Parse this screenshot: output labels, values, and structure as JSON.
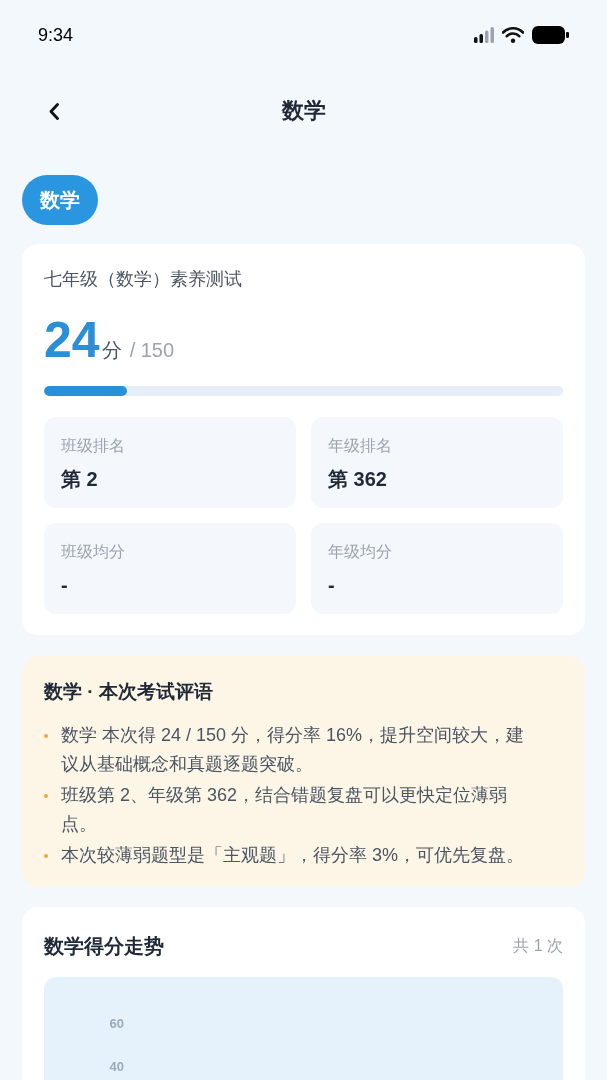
{
  "status_bar": {
    "time": "9:34"
  },
  "header": {
    "title": "数学"
  },
  "subject_tabs": [
    {
      "label": "数学",
      "selected": true
    }
  ],
  "score_card": {
    "exam_title": "七年级（数学）素养测试",
    "score": "24",
    "unit": "分",
    "total": "/ 150",
    "progress": {
      "level": 0.16
    },
    "stats": [
      {
        "label": "班级排名",
        "value": "第 2"
      },
      {
        "label": "年级排名",
        "value": "第 362"
      },
      {
        "label": "班级均分",
        "value": "-"
      },
      {
        "label": "年级均分",
        "value": "-"
      }
    ]
  },
  "comment_card": {
    "title": "数学 · 本次考试评语",
    "items": [
      "数学 本次得 24 / 150 分，得分率 16%，提升空间较大，建议从基础概念和真题逐题突破。",
      "班级第 2、年级第 362，结合错题复盘可以更快定位薄弱点。",
      "本次较薄弱题型是「主观题」，得分率 3%，可优先复盘。"
    ]
  },
  "trend_card": {
    "title": "数学得分走势",
    "count": "共 1 次",
    "y_axis_labels": [
      "60",
      "40"
    ]
  }
}
